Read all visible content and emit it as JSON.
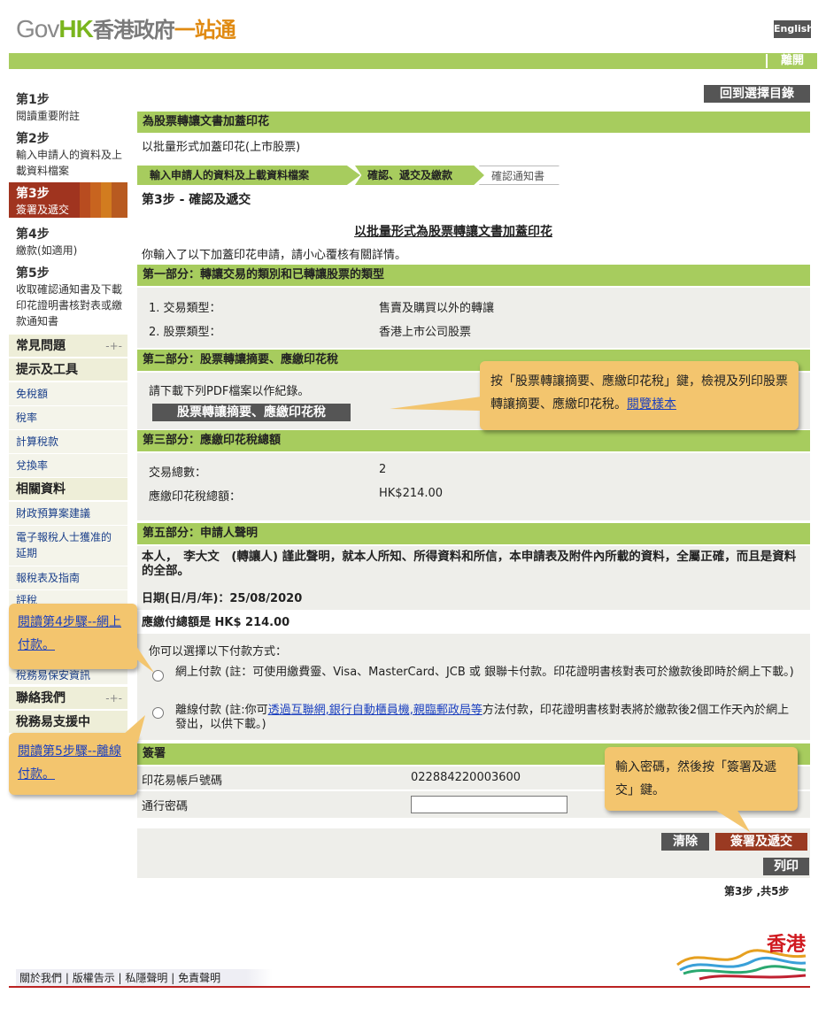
{
  "header": {
    "logo_gov": "Gov",
    "logo_hk": "HK",
    "logo_zh": "香港政府",
    "logo_zh2": "一站通",
    "lang_label": "English",
    "exit_label": "離開"
  },
  "sidebar": {
    "steps": [
      {
        "num": "第1步",
        "text": "閱讀重要附註"
      },
      {
        "num": "第2步",
        "text": "輸入申請人的資料及上載資料檔案"
      },
      {
        "num": "第3步",
        "text": "簽署及遞交"
      },
      {
        "num": "第4步",
        "text": "繳款(如適用)"
      },
      {
        "num": "第5步",
        "text": "收取確認通知書及下載印花證明書核對表或繳款通知書"
      }
    ],
    "faq": "常見問題",
    "tools": "提示及工具",
    "tool_links": [
      "免稅額",
      "稅率",
      "計算稅款",
      "兌換率"
    ],
    "related": "相關資料",
    "related_links": [
      "財政預算案建議",
      "電子報稅人士獲准的延期",
      "報稅表及指南",
      "評稅",
      "稅務易保安資訊"
    ],
    "contact": "聯絡我們",
    "support": "稅務易支援中"
  },
  "main": {
    "back_label": "回到選擇目錄",
    "title": "為股票轉讓文書加蓋印花",
    "subtitle": "以批量形式加蓋印花(上市股票)",
    "breadcrumb": [
      "輸入申請人的資料及上載資料檔案",
      "確認、遞交及繳款",
      "確認通知書"
    ],
    "step_heading": "第3步 - 確認及遞交",
    "form_title": "以批量形式為股票轉讓文書加蓋印花",
    "intro": "你輸入了以下加蓋印花申請，請小心覆核有關詳情。",
    "part1": {
      "title": "第一部分：轉讓交易的類別和已轉讓股票的類型",
      "row1_label": "1. 交易類型：",
      "row1_value": "售賣及購買以外的轉讓",
      "row2_label": "2. 股票類型：",
      "row2_value": "香港上市公司股票"
    },
    "part2": {
      "title": "第二部分：股票轉讓摘要、應繳印花稅",
      "instruction": "請下載下列PDF檔案以作紀錄。",
      "button": "股票轉讓摘要、應繳印花稅"
    },
    "part3": {
      "title": "第三部分：應繳印花稅總額",
      "row1_label": "交易總數：",
      "row1_value": "2",
      "row2_label": "應繳印花稅總額：",
      "row2_value": "HK$214.00"
    },
    "part5": {
      "title": "第五部分：申請人聲明",
      "declaration": "本人，　李大文　(轉讓人) 謹此聲明，就本人所知、所得資料和所信，本申請表及附件內所載的資料，全屬正確，而且是資料的全部。",
      "date": "日期(日/月/年)：25/08/2020",
      "amount": "應繳付總額是 HK$ 214.00",
      "pay_intro": "你可以選擇以下付款方式：",
      "online": "網上付款 (註：可使用繳費靈、Visa、MasterCard、JCB 或 銀聯卡付款。印花證明書核對表可於繳款後即時於網上下載。)",
      "offline_pre": "離線付款 (註:你可",
      "offline_link": "透過互聯網,銀行自動櫃員機,親臨郵政局等",
      "offline_post": "方法付款，印花證明書核對表將於繳款後2個工作天內於網上發出，以供下載。)"
    },
    "sign": {
      "title": "簽署",
      "account_label": "印花易帳戶號碼",
      "account_value": "022884220003600",
      "password_label": "通行密碼",
      "password_value": ""
    },
    "clear_label": "清除",
    "submit_label": "簽署及遞交",
    "print_label": "列印",
    "progress": "第3步 ,共5步"
  },
  "callouts": {
    "c1_text": "按「股票轉讓摘要、應繳印花稅」鍵，檢視及列印股票轉讓摘要、應繳印花稅。",
    "c1_link": "閱覽樣本",
    "c2": "閱讀第4步驟--網上付款。",
    "c3": "閱讀第5步驟--離線付款。",
    "c4": "輸入密碼，然後按「簽署及遞交」鍵。"
  },
  "footer": {
    "links": [
      "關於我們",
      "版權告示",
      "私隱聲明",
      "免責聲明"
    ],
    "brand": "香港"
  }
}
